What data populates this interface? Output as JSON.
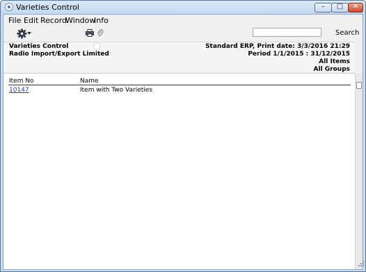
{
  "window": {
    "title": "Varieties Control",
    "controls": {
      "minimize": "–",
      "maximize": "□",
      "close": "✕"
    }
  },
  "menu": [
    "File",
    "Edit",
    "Record",
    "Window",
    "Info"
  ],
  "toolbar": {
    "search_label": "Search",
    "search_value": "",
    "icons": [
      "gear-icon",
      "print-icon",
      "attachment-icon"
    ]
  },
  "report_header": {
    "report_name": "Varieties Control",
    "company": "Radio Import/Export Limited",
    "system_print_date": "Standard ERP, Print date: 3/3/2016 21:29",
    "period": "Period  1/1/2015 : 31/12/2015",
    "items_filter": "All Items",
    "groups_filter": "All Groups"
  },
  "list": {
    "columns": [
      "Item No",
      "Name"
    ],
    "rows": [
      {
        "item_no": "10147",
        "name": "Item with Two Varieties"
      }
    ]
  },
  "colors": {
    "titlebar": "#c9ddf1",
    "link": "#1a3cc8",
    "close_button": "#c9472c"
  }
}
